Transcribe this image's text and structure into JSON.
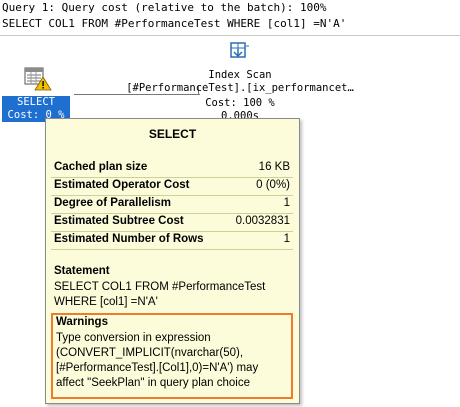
{
  "query": {
    "header": "Query 1: Query cost (relative to the batch): 100%",
    "sql": "SELECT COL1 FROM #PerformanceTest WHERE [col1] =N'A'"
  },
  "select_node": {
    "label_line1": "SELECT",
    "label_line2": "Cost: 0 %",
    "icon": "select-warning-icon"
  },
  "scan_node": {
    "line1": "Index Scan",
    "line2": "[#PerformanceTest].[ix_performancet…",
    "line3": "Cost: 100 %",
    "line4": "0.000s",
    "icon": "index-scan-icon"
  },
  "tooltip": {
    "title": "SELECT",
    "properties": [
      {
        "key": "Cached plan size",
        "value": "16 KB"
      },
      {
        "key": "Estimated Operator Cost",
        "value": "0 (0%)"
      },
      {
        "key": "Degree of Parallelism",
        "value": "1"
      },
      {
        "key": "Estimated Subtree Cost",
        "value": "0.0032831"
      },
      {
        "key": "Estimated Number of Rows",
        "value": "1"
      }
    ],
    "statement_heading": "Statement",
    "statement_line1": "SELECT COL1 FROM #PerformanceTest",
    "statement_line2": "WHERE [col1] =N'A'",
    "warnings_heading": "Warnings",
    "warning_lines": [
      "Type conversion in expression",
      "(CONVERT_IMPLICIT(nvarchar(50),",
      "[#PerformanceTest].[Col1],0)=N'A') may",
      "affect \"SeekPlan\" in query plan choice"
    ]
  },
  "colors": {
    "selected_node": "#1f6fd0",
    "tooltip_bg": "#fcfcda",
    "warning_border": "#ef7c2a",
    "warning_icon": "#f2c200"
  }
}
